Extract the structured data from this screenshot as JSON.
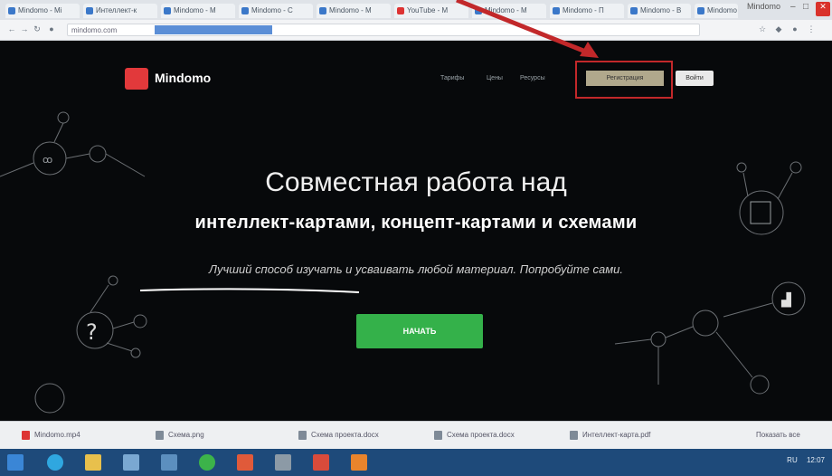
{
  "browser": {
    "tabs": [
      {
        "label": "Mindomo - Mi"
      },
      {
        "label": "Интеллект-к"
      },
      {
        "label": "Mindomo - М"
      },
      {
        "label": "Mindomo - С"
      },
      {
        "label": "Mindomo - М"
      },
      {
        "label": "YouTube - М"
      },
      {
        "label": "Mindomo - М"
      },
      {
        "label": "Mindomo - П"
      },
      {
        "label": "Mindomo - В"
      },
      {
        "label": "Mindomo - М"
      }
    ],
    "window_label": "Mindomo",
    "address": "mindomo.com",
    "address_extra": "www.mindomo.com/ru/"
  },
  "site": {
    "brand": "Mindomo",
    "nav": [
      "Тарифы",
      "Цены",
      "Ресурсы"
    ],
    "signup": "Регистрация",
    "login": "Войти"
  },
  "hero": {
    "title": "Совместная работа над",
    "subtitle": "интеллект-картами, концепт-картами и схемами",
    "description": "Лучший способ изучать и усваивать любой материал. Попробуйте сами.",
    "cta": "НАЧАТЬ"
  },
  "downloads": [
    {
      "label": "Mindomo.mp4"
    },
    {
      "label": "Схема.png"
    },
    {
      "label": "Схема проекта.docx"
    },
    {
      "label": "Схема проекта.docx"
    },
    {
      "label": "Интеллект-карта.pdf"
    }
  ],
  "downloads_show_all": "Показать все",
  "tray": {
    "time": "12:07",
    "lang": "RU"
  },
  "colors": {
    "accent_red": "#c2282a",
    "cta_green": "#34b14a",
    "page_bg": "#07090b",
    "taskbar": "#1e4a7a"
  }
}
